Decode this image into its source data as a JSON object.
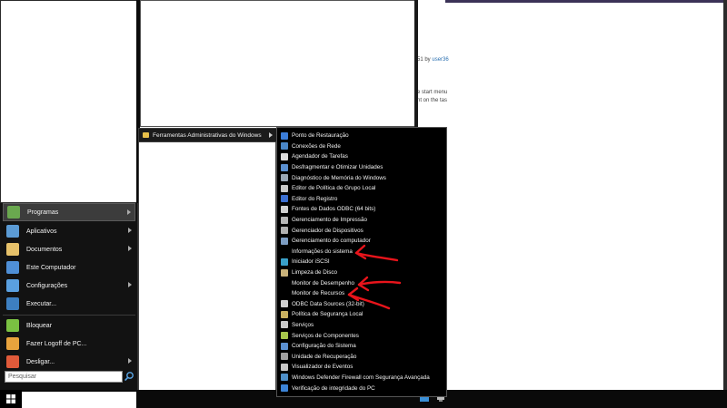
{
  "background": {
    "byline_prefix": "51 by ",
    "byline_user": "user36",
    "line1": "e start menu",
    "line2": "nt on the tas"
  },
  "start_menu": {
    "items": [
      {
        "label": "Programas",
        "icon": "programs-icon",
        "color": "#6aa84f"
      },
      {
        "label": "Aplicativos",
        "icon": "apps-icon",
        "color": "#5b9bd5"
      },
      {
        "label": "Documentos",
        "icon": "documents-icon",
        "color": "#e6c16a"
      },
      {
        "label": "Este Computador",
        "icon": "computer-icon",
        "color": "#4f8fd6"
      },
      {
        "label": "Configurações",
        "icon": "settings-icon",
        "color": "#5aa0e0"
      },
      {
        "label": "Executar...",
        "icon": "run-icon",
        "color": "#3d7fc1"
      },
      {
        "label": "Bloquear",
        "icon": "lock-icon",
        "color": "#7ac142"
      },
      {
        "label": "Fazer Logoff de PC...",
        "icon": "logoff-icon",
        "color": "#e8a33d"
      },
      {
        "label": "Desligar...",
        "icon": "power-icon",
        "color": "#e05a3a"
      }
    ],
    "search_placeholder": "Pesquisar"
  },
  "submenu": {
    "label": "Ferramentas Administrativas do Windows"
  },
  "tools": [
    {
      "label": "Ponto de Restauração",
      "icon": "restore-point-icon",
      "color": "#3b7dd8"
    },
    {
      "label": "Conexões de Rede",
      "icon": "network-icon",
      "color": "#4a86c7"
    },
    {
      "label": "Agendador de Tarefas",
      "icon": "task-scheduler-icon",
      "color": "#dcdcdc"
    },
    {
      "label": "Desfragmentar e Otimizar Unidades",
      "icon": "defrag-icon",
      "color": "#5a8fd0"
    },
    {
      "label": "Diagnóstico de Memória do Windows",
      "icon": "memory-icon",
      "color": "#9aa7b5"
    },
    {
      "label": "Editor de Política de Grupo Local",
      "icon": "gpedit-icon",
      "color": "#c9c9c9"
    },
    {
      "label": "Editor do Registro",
      "icon": "regedit-icon",
      "color": "#3c6fd1"
    },
    {
      "label": "Fontes de Dados ODBC (64 bits)",
      "icon": "odbc-icon",
      "color": "#d0d0d0"
    },
    {
      "label": "Gerenciamento de Impressão",
      "icon": "print-icon",
      "color": "#b7b7b7"
    },
    {
      "label": "Gerenciador de Dispositivos",
      "icon": "device-manager-icon",
      "color": "#b0b0b0"
    },
    {
      "label": "Gerenciamento do computador",
      "icon": "computer-management-icon",
      "color": "#7d9dc2"
    },
    {
      "label": "Informações do sistema",
      "icon": "",
      "color": ""
    },
    {
      "label": "Iniciador iSCSI",
      "icon": "iscsi-icon",
      "color": "#3aa0c8"
    },
    {
      "label": "Limpeza de Disco",
      "icon": "disk-cleanup-icon",
      "color": "#c9b27a"
    },
    {
      "label": "Monitor de Desempenho",
      "icon": "",
      "color": ""
    },
    {
      "label": "Monitor de Recursos",
      "icon": "",
      "color": ""
    },
    {
      "label": "ODBC Data Sources (32-bit)",
      "icon": "odbc32-icon",
      "color": "#d0d0d0"
    },
    {
      "label": "Política de Segurança Local",
      "icon": "security-policy-icon",
      "color": "#c8b060"
    },
    {
      "label": "Serviços",
      "icon": "services-icon",
      "color": "#c8c8c8"
    },
    {
      "label": "Serviços de Componentes",
      "icon": "component-services-icon",
      "color": "#a6c64c"
    },
    {
      "label": "Configuração do Sistema",
      "icon": "msconfig-icon",
      "color": "#5a8fd0"
    },
    {
      "label": "Unidade de Recuperação",
      "icon": "recovery-drive-icon",
      "color": "#a0a0a0"
    },
    {
      "label": "Visualizador de Eventos",
      "icon": "event-viewer-icon",
      "color": "#c8c8c8"
    },
    {
      "label": "Windows Defender Firewall com Segurança Avançada",
      "icon": "firewall-icon",
      "color": "#4e8fc8"
    },
    {
      "label": "Verificação de integridade do PC",
      "icon": "pc-health-icon",
      "color": "#3c84d8"
    }
  ],
  "colors": {
    "annotation": "#e8141b",
    "menu_bg": "#000000",
    "highlight": "#3c3c3c"
  }
}
